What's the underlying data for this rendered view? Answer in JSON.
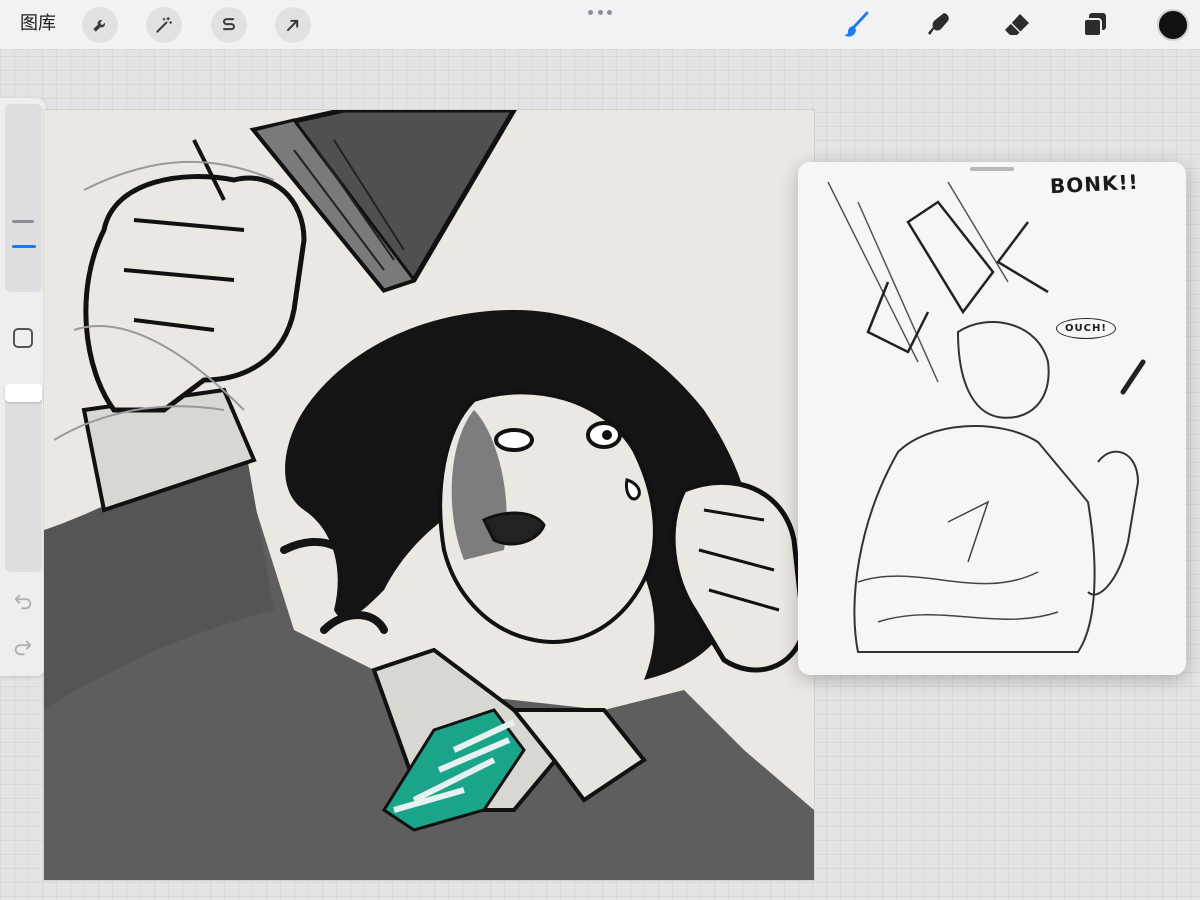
{
  "toolbar": {
    "gallery_label": "图库",
    "actions": [
      {
        "name": "actions-wrench",
        "icon": "wrench-icon"
      },
      {
        "name": "adjustments",
        "icon": "magic-wand-icon"
      },
      {
        "name": "selection",
        "icon": "selection-s-icon"
      },
      {
        "name": "transform",
        "icon": "arrow-cursor-icon"
      }
    ],
    "tools": [
      {
        "name": "brush",
        "icon": "brush-icon",
        "active": true
      },
      {
        "name": "smudge",
        "icon": "smudge-icon",
        "active": false
      },
      {
        "name": "eraser",
        "icon": "eraser-icon",
        "active": false
      },
      {
        "name": "layers",
        "icon": "layers-icon",
        "active": false
      }
    ],
    "current_color": "#111111",
    "active_color": "#1a7cf0"
  },
  "sidebar": {
    "brush_size_icon": "size-slider",
    "modify_icon": "square-icon",
    "undo_icon": "undo-icon",
    "redo_icon": "redo-icon"
  },
  "reference": {
    "sfx_bonk": "BONK!!",
    "sfx_ouch": "OUCH!"
  },
  "colors": {
    "canvas_bg": "#ebe8e3",
    "ink": "#111111",
    "tie_accent": "#1aa58b",
    "sweater_gray": "#5a5a5a"
  }
}
